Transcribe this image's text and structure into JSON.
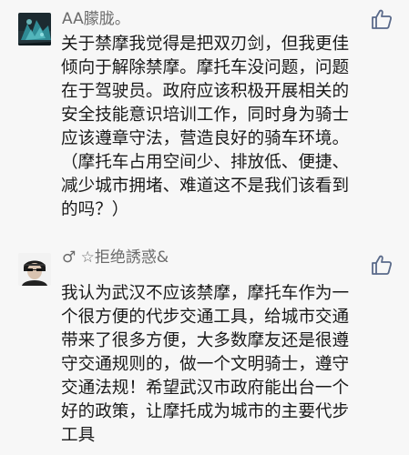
{
  "comments": [
    {
      "username": "AA朦胧。",
      "lines": [
        "关于禁摩我觉得是把双刃剑，但我更佳",
        "倾向于解除禁摩。摩托车没问题，问题",
        "在于驾驶员。政府应该积极开展相关的",
        "安全技能意识培训工作，同时身为骑士",
        "应该遵章守法，营造良好的骑车环境。",
        "（摩托车占用空间少、排放低、便捷、",
        "减少城市拥堵、难道这不是我们该看到",
        "的吗？）"
      ]
    },
    {
      "username": "♂ ☆拒绝誘惑&",
      "lines": [
        "我认为武汉不应该禁摩，摩托车作为一",
        "个很方便的代步交通工具，给城市交通",
        "带来了很多方便，大多数摩友还是很遵",
        "守交通规则的，做一个文明骑士，遵守",
        "交通法规！希望武汉市政府能出台一个",
        "好的政策，让摩托成为城市的主要代步",
        "工具"
      ]
    }
  ],
  "colors": {
    "background": "#f7f7f7",
    "username": "#6b6b6b",
    "text": "#1a1a1a",
    "like_icon": "#5a6a8a"
  },
  "icons": [
    "thumbs-up-icon",
    "avatar-image"
  ]
}
